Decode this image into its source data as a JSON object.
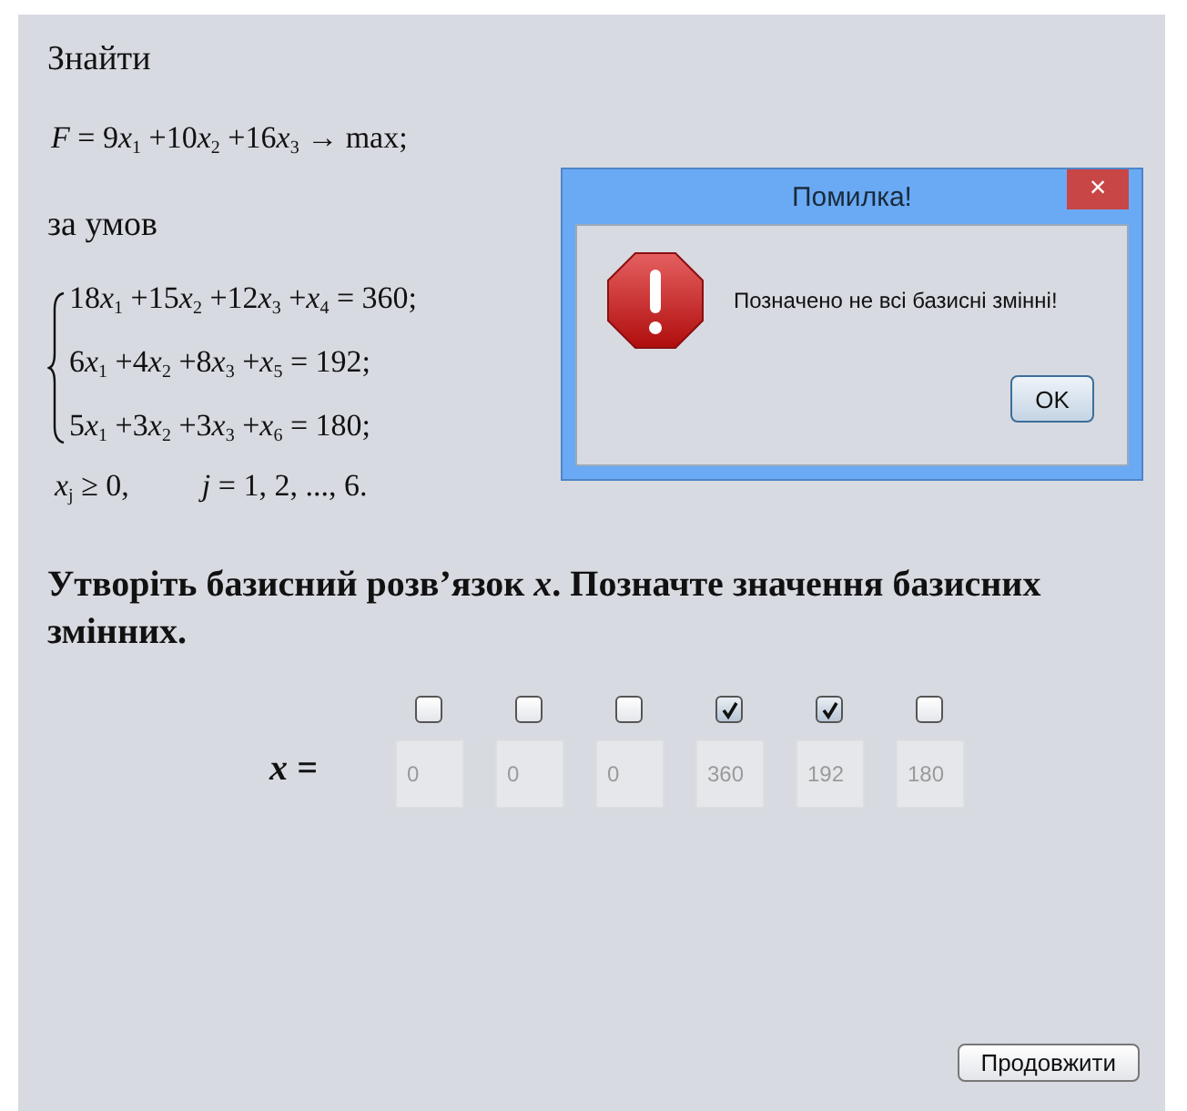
{
  "task": {
    "find_label": "Знайти",
    "objective": [
      {
        "kind": "var",
        "text": "F"
      },
      {
        "kind": "num",
        "text": " = 9"
      },
      {
        "kind": "var",
        "text": "x"
      },
      {
        "kind": "sub",
        "text": "1"
      },
      {
        "kind": "num",
        "text": " +10"
      },
      {
        "kind": "var",
        "text": "x"
      },
      {
        "kind": "sub",
        "text": "2"
      },
      {
        "kind": "num",
        "text": " +16"
      },
      {
        "kind": "var",
        "text": "x"
      },
      {
        "kind": "sub",
        "text": "3"
      },
      {
        "kind": "num",
        "text": " → max;"
      }
    ],
    "conditions_label": "за умов",
    "constraints": [
      [
        {
          "kind": "num",
          "text": "18"
        },
        {
          "kind": "var",
          "text": "x"
        },
        {
          "kind": "sub",
          "text": "1"
        },
        {
          "kind": "num",
          "text": " +15"
        },
        {
          "kind": "var",
          "text": "x"
        },
        {
          "kind": "sub",
          "text": "2"
        },
        {
          "kind": "num",
          "text": " +12"
        },
        {
          "kind": "var",
          "text": "x"
        },
        {
          "kind": "sub",
          "text": "3"
        },
        {
          "kind": "num",
          "text": " +"
        },
        {
          "kind": "var",
          "text": "x"
        },
        {
          "kind": "sub",
          "text": "4"
        },
        {
          "kind": "num",
          "text": " = 360;"
        }
      ],
      [
        {
          "kind": "num",
          "text": "6"
        },
        {
          "kind": "var",
          "text": "x"
        },
        {
          "kind": "sub",
          "text": "1"
        },
        {
          "kind": "num",
          "text": " +4"
        },
        {
          "kind": "var",
          "text": "x"
        },
        {
          "kind": "sub",
          "text": "2"
        },
        {
          "kind": "num",
          "text": " +8"
        },
        {
          "kind": "var",
          "text": "x"
        },
        {
          "kind": "sub",
          "text": "3"
        },
        {
          "kind": "num",
          "text": " +"
        },
        {
          "kind": "var",
          "text": "x"
        },
        {
          "kind": "sub",
          "text": "5"
        },
        {
          "kind": "num",
          "text": " = 192;"
        }
      ],
      [
        {
          "kind": "num",
          "text": "5"
        },
        {
          "kind": "var",
          "text": "x"
        },
        {
          "kind": "sub",
          "text": "1"
        },
        {
          "kind": "num",
          "text": " +3"
        },
        {
          "kind": "var",
          "text": "x"
        },
        {
          "kind": "sub",
          "text": "2"
        },
        {
          "kind": "num",
          "text": " +3"
        },
        {
          "kind": "var",
          "text": "x"
        },
        {
          "kind": "sub",
          "text": "3"
        },
        {
          "kind": "num",
          "text": " +"
        },
        {
          "kind": "var",
          "text": "x"
        },
        {
          "kind": "sub",
          "text": "6"
        },
        {
          "kind": "num",
          "text": " = 180;"
        }
      ]
    ],
    "nonnegativity": [
      {
        "kind": "var",
        "text": "x"
      },
      {
        "kind": "sub",
        "text": "j"
      },
      {
        "kind": "num",
        "text": " ≥ 0,"
      }
    ],
    "index_range": [
      {
        "kind": "var",
        "text": "j"
      },
      {
        "kind": "num",
        "text": " = 1, 2, ..., 6."
      }
    ]
  },
  "question": "Утворіть базисний розв’язок *x*. Позначте значення базисних змінних.",
  "vector_label": "x =",
  "variables": [
    {
      "checked": false,
      "value": "0"
    },
    {
      "checked": false,
      "value": "0"
    },
    {
      "checked": false,
      "value": "0"
    },
    {
      "checked": true,
      "value": "360"
    },
    {
      "checked": true,
      "value": "192"
    },
    {
      "checked": false,
      "value": "180"
    }
  ],
  "continue_button": "Продовжити",
  "dialog": {
    "title": "Помилка!",
    "close": "×",
    "message": "Позначено не всі базисні змінні!",
    "ok": "OK"
  }
}
